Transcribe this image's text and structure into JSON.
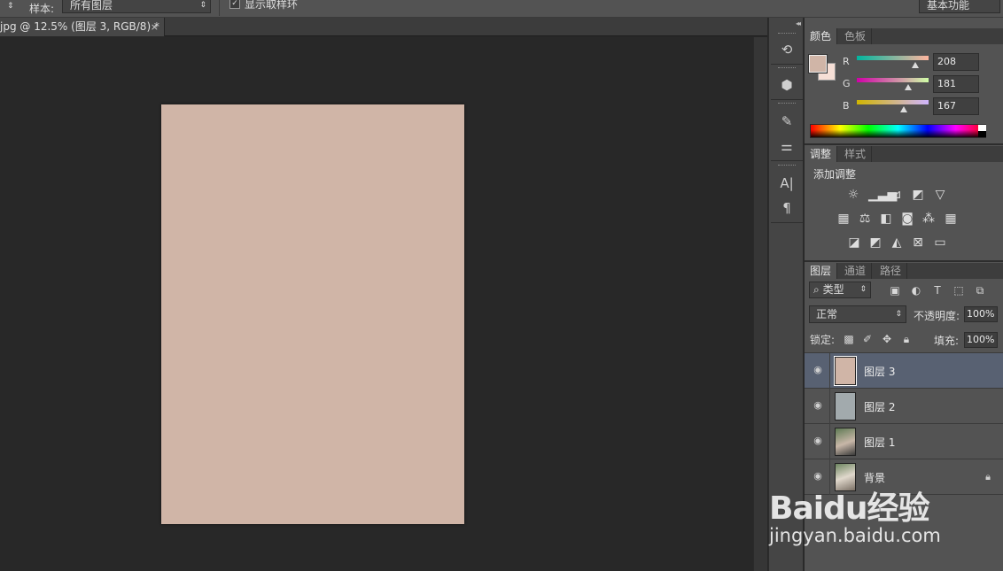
{
  "options_bar": {
    "sample_label": "样本:",
    "sample_value": "所有图层",
    "show_ring_label": "显示取样环",
    "workspace_value": "基本功能"
  },
  "document_tab": {
    "title": "jpg @ 12.5% (图层 3, RGB/8) *",
    "close_glyph": "×"
  },
  "canvas": {
    "fill_color": "#d0b5a7"
  },
  "color_panel": {
    "tabs": [
      "颜色",
      "色板"
    ],
    "foreground": "#d0b5a7",
    "background": "#f6dfd6",
    "channels": [
      {
        "label": "R",
        "value": "208",
        "level": 0.816
      },
      {
        "label": "G",
        "value": "181",
        "level": 0.71
      },
      {
        "label": "B",
        "value": "167",
        "level": 0.655
      }
    ]
  },
  "adjustments_panel": {
    "tabs": [
      "调整",
      "样式"
    ],
    "title": "添加调整",
    "icons": [
      "brightness-icon",
      "levels-icon",
      "curves-icon",
      "exposure-icon",
      "vibrance-icon",
      "hue-saturation-icon",
      "color-balance-icon",
      "black-white-icon",
      "photo-filter-icon",
      "channel-mixer-icon",
      "color-lookup-icon",
      "invert-icon",
      "posterize-icon",
      "threshold-icon",
      "selective-color-icon",
      "gradient-map-icon"
    ]
  },
  "layers_panel": {
    "tabs": [
      "图层",
      "通道",
      "路径"
    ],
    "filter_value": "类型",
    "blend_mode": "正常",
    "opacity_label": "不透明度:",
    "opacity_value": "100%",
    "lock_label": "锁定:",
    "fill_label": "填充:",
    "fill_value": "100%",
    "layers": [
      {
        "name": "图层 3",
        "selected": true,
        "thumb_color": "#d0b5a7"
      },
      {
        "name": "图层 2",
        "selected": false,
        "thumb_color": "#a2aaad"
      },
      {
        "name": "图层 1",
        "selected": false,
        "thumb_color": "#8a9a7e"
      },
      {
        "name": "背景",
        "selected": false,
        "thumb_color": "#c9c3b8",
        "locked": true
      }
    ]
  },
  "watermark": {
    "logo": "Baidu经验",
    "url": "jingyan.baidu.com"
  }
}
